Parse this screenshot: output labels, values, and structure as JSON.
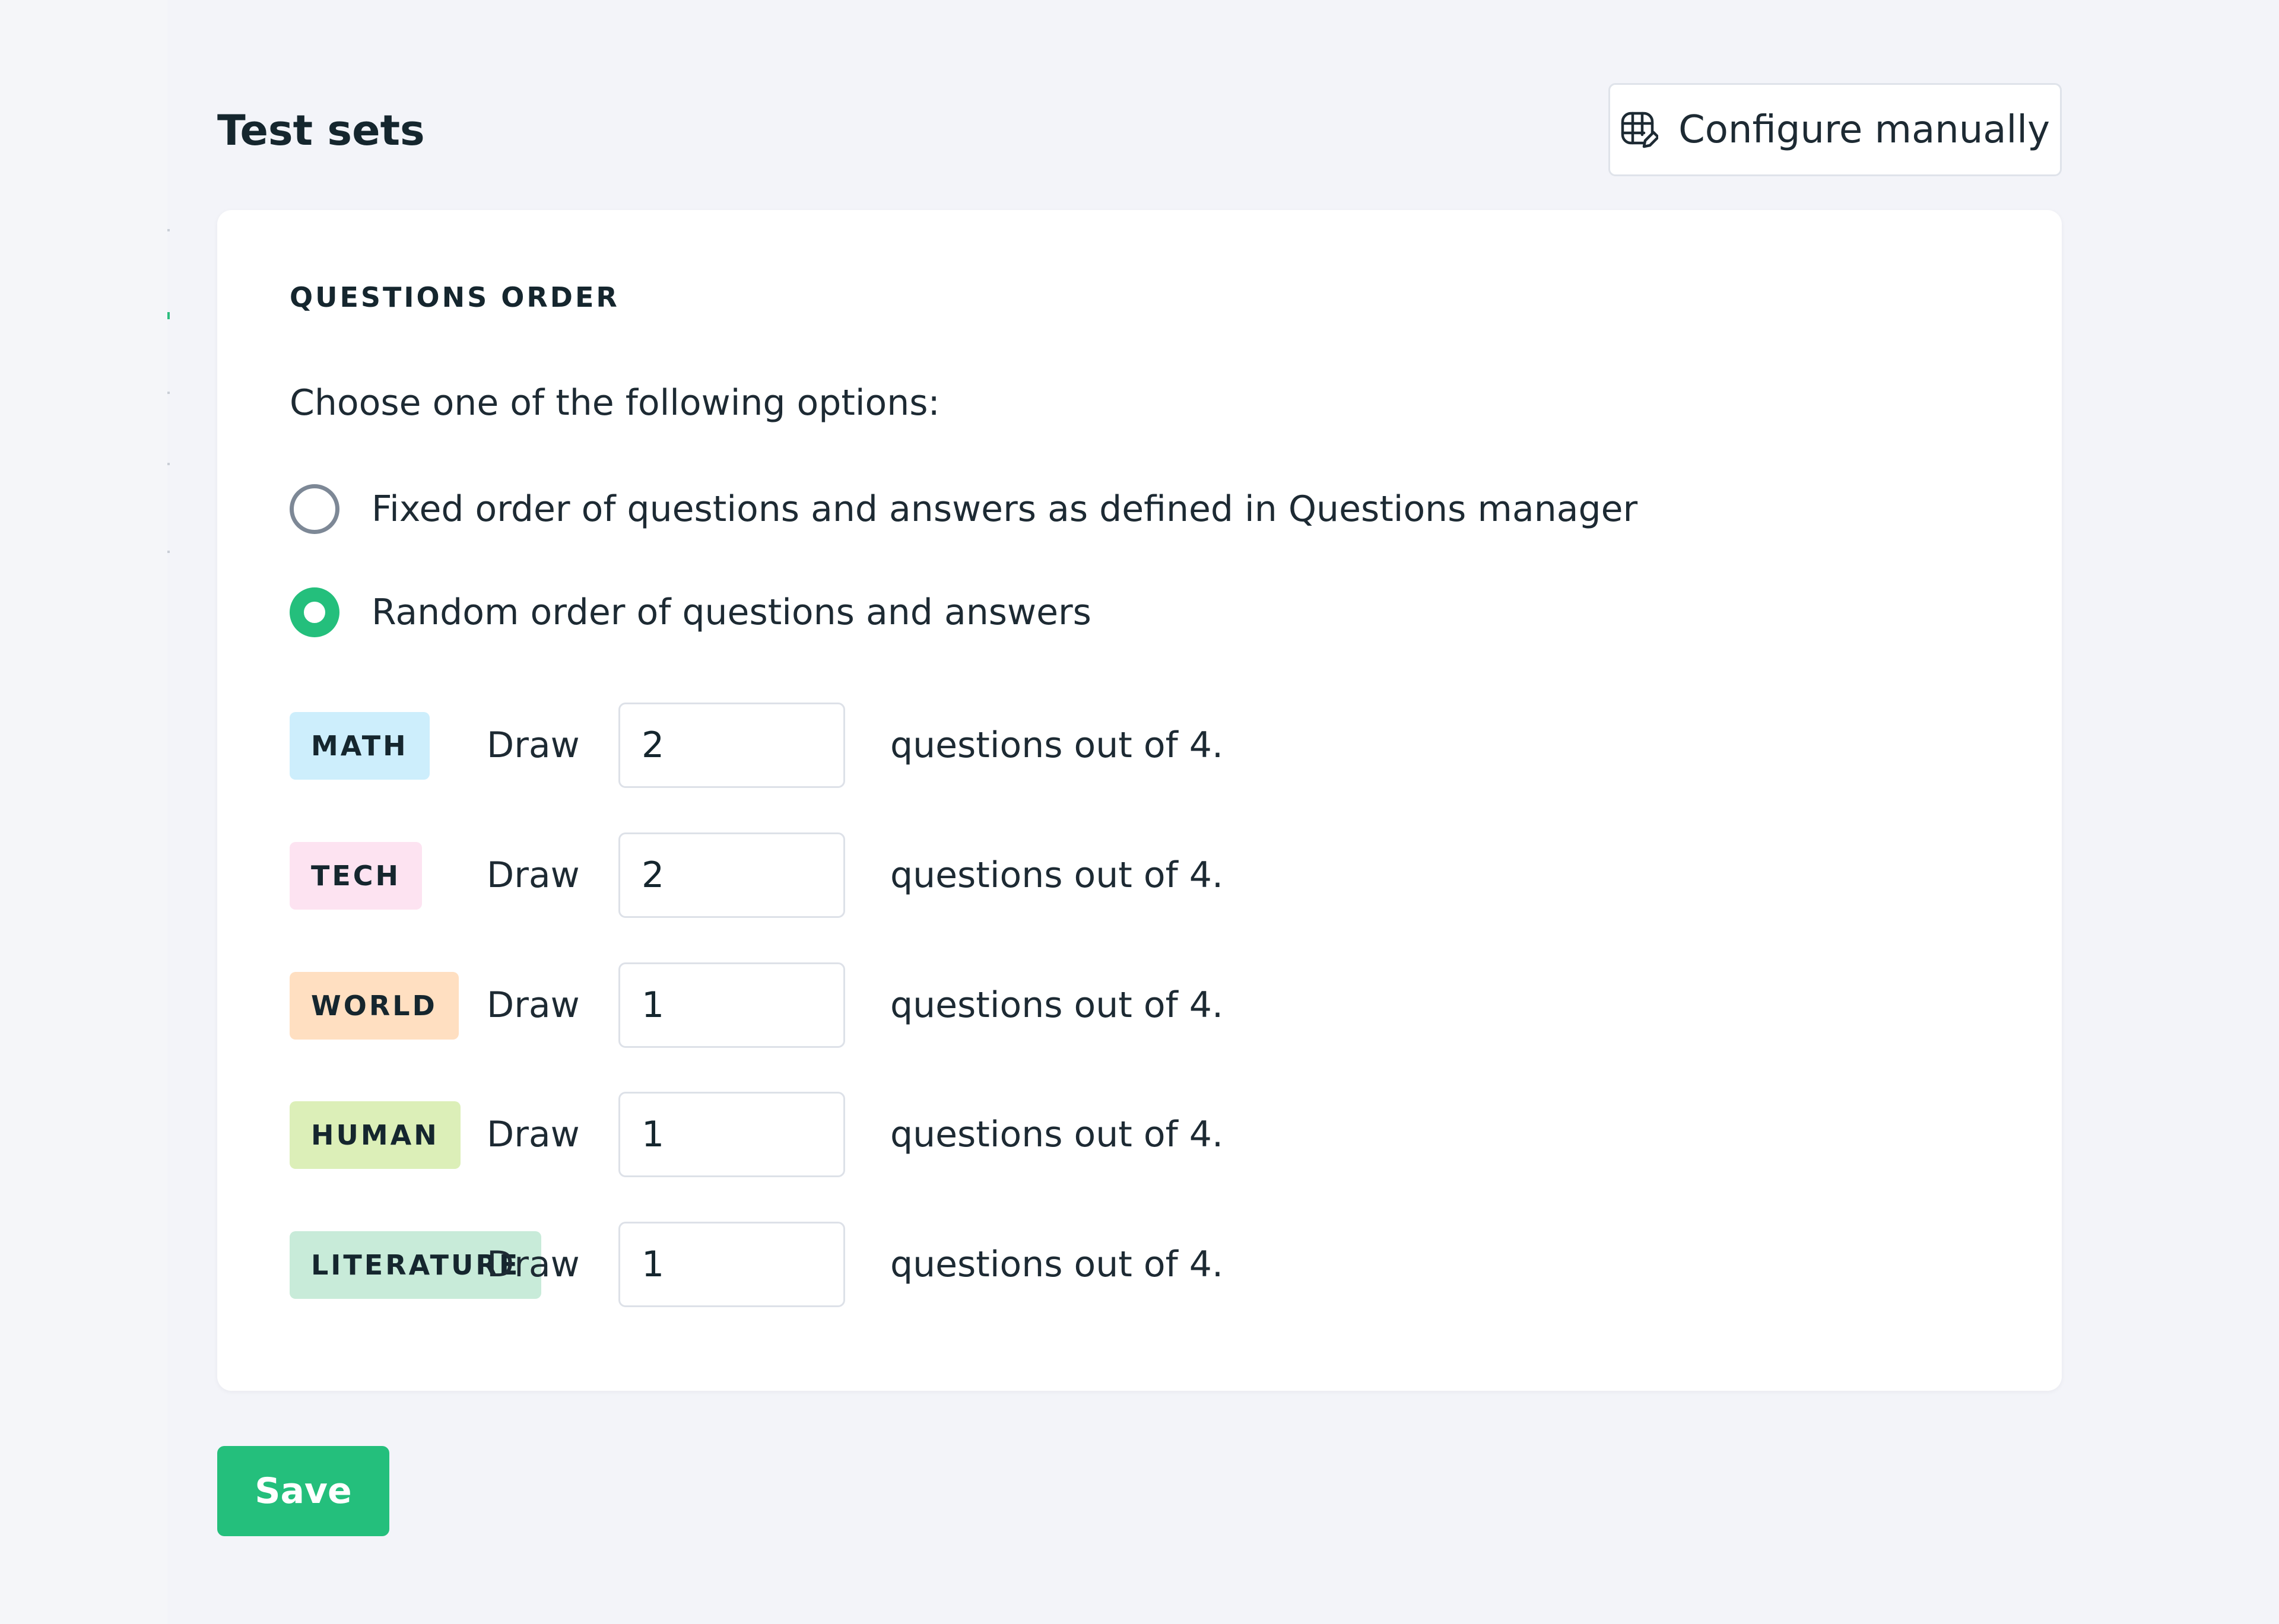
{
  "header": {
    "title": "Test sets",
    "configure_label": "Configure manually",
    "configure_icon": "grid-edit-icon"
  },
  "questions_order": {
    "section_label": "QUESTIONS ORDER",
    "instructions": "Choose one of the following options:",
    "options": [
      {
        "label": "Fixed order of questions and answers as defined in Questions manager",
        "selected": false
      },
      {
        "label": "Random order of questions and answers",
        "selected": true
      }
    ],
    "draw_label": "Draw",
    "categories": [
      {
        "tag": "MATH",
        "tag_color": "#cdeefc",
        "value": "2",
        "suffix": "questions out of 4."
      },
      {
        "tag": "TECH",
        "tag_color": "#fde3f1",
        "value": "2",
        "suffix": "questions out of 4."
      },
      {
        "tag": "WORLD",
        "tag_color": "#ffdfc1",
        "value": "1",
        "suffix": "questions out of 4."
      },
      {
        "tag": "HUMAN",
        "tag_color": "#dcefb8",
        "value": "1",
        "suffix": "questions out of 4."
      },
      {
        "tag": "LITERATURE",
        "tag_color": "#c8ebd9",
        "value": "1",
        "suffix": "questions out of 4."
      }
    ]
  },
  "footer": {
    "save_label": "Save"
  },
  "colors": {
    "accent": "#24bf7c",
    "page_background": "#f3f4f9",
    "card_background": "#ffffff",
    "text": "#1d2a33"
  }
}
